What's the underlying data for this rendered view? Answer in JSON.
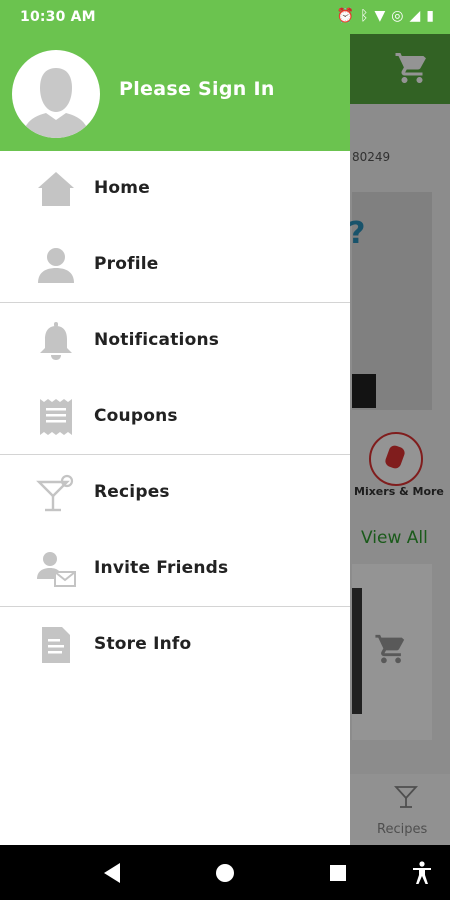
{
  "status_bar": {
    "time": "10:30 AM",
    "icons": [
      "alarm-icon",
      "bluetooth-icon",
      "wifi-icon",
      "cast-icon",
      "signal-icon",
      "battery-icon"
    ]
  },
  "drawer": {
    "header": {
      "sign_in_label": "Please Sign In",
      "background_color": "#6bc34f"
    },
    "menu_groups": [
      [
        {
          "label": "Home",
          "icon": "home-icon"
        },
        {
          "label": "Profile",
          "icon": "person-icon"
        }
      ],
      [
        {
          "label": "Notifications",
          "icon": "bell-icon"
        },
        {
          "label": "Coupons",
          "icon": "coupon-icon"
        }
      ],
      [
        {
          "label": "Recipes",
          "icon": "cocktail-glass-icon"
        },
        {
          "label": "Invite Friends",
          "icon": "invite-friends-icon"
        }
      ],
      [
        {
          "label": "Store Info",
          "icon": "document-icon"
        }
      ]
    ]
  },
  "background_app": {
    "store_id_fragment": "80249",
    "banner_glyph": "?",
    "category_label": "Mixers & More",
    "view_all_label": "View All",
    "bottom_tab_label": "Recipes"
  },
  "colors": {
    "brand_green": "#6bc34f",
    "icon_gray": "#c4c4c4"
  }
}
